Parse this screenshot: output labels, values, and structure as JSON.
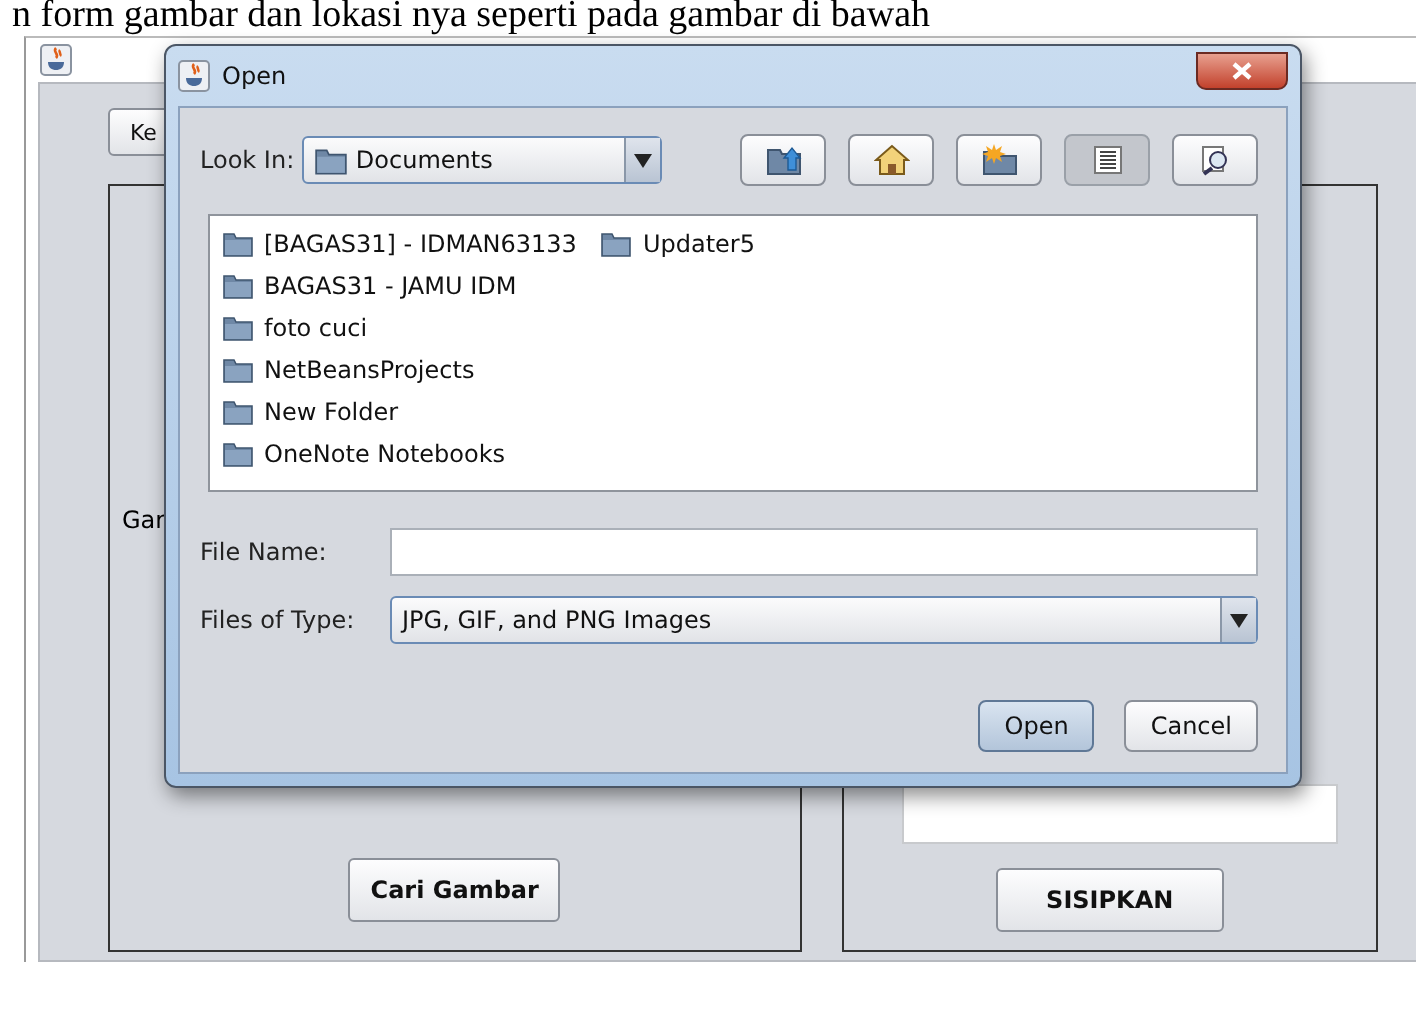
{
  "document_text": "n form gambar dan lokasi nya seperti pada gambar di bawah",
  "main_window": {
    "top_button": "Ke",
    "left_panel": {
      "label": "Gar",
      "button": "Cari Gambar"
    },
    "right_panel": {
      "button": "SISIPKAN"
    }
  },
  "dialog": {
    "title": "Open",
    "look_in": {
      "label": "Look In:",
      "value": "Documents"
    },
    "toolbar": [
      {
        "kind": "up",
        "selected": false
      },
      {
        "kind": "home",
        "selected": false
      },
      {
        "kind": "new_folder",
        "selected": false
      },
      {
        "kind": "list",
        "selected": true
      },
      {
        "kind": "details",
        "selected": false
      }
    ],
    "files": [
      "[BAGAS31] - IDMAN63133",
      "BAGAS31 - JAMU IDM",
      "foto cuci",
      "NetBeansProjects",
      "New Folder",
      "OneNote Notebooks",
      "Updater5"
    ],
    "file_name": {
      "label": "File Name:"
    },
    "files_of_type": {
      "label": "Files of Type:",
      "value": "JPG, GIF, and PNG Images"
    },
    "buttons": [
      {
        "label": "Open",
        "kind": "default"
      },
      {
        "label": "Cancel",
        "kind": "normal"
      }
    ]
  }
}
